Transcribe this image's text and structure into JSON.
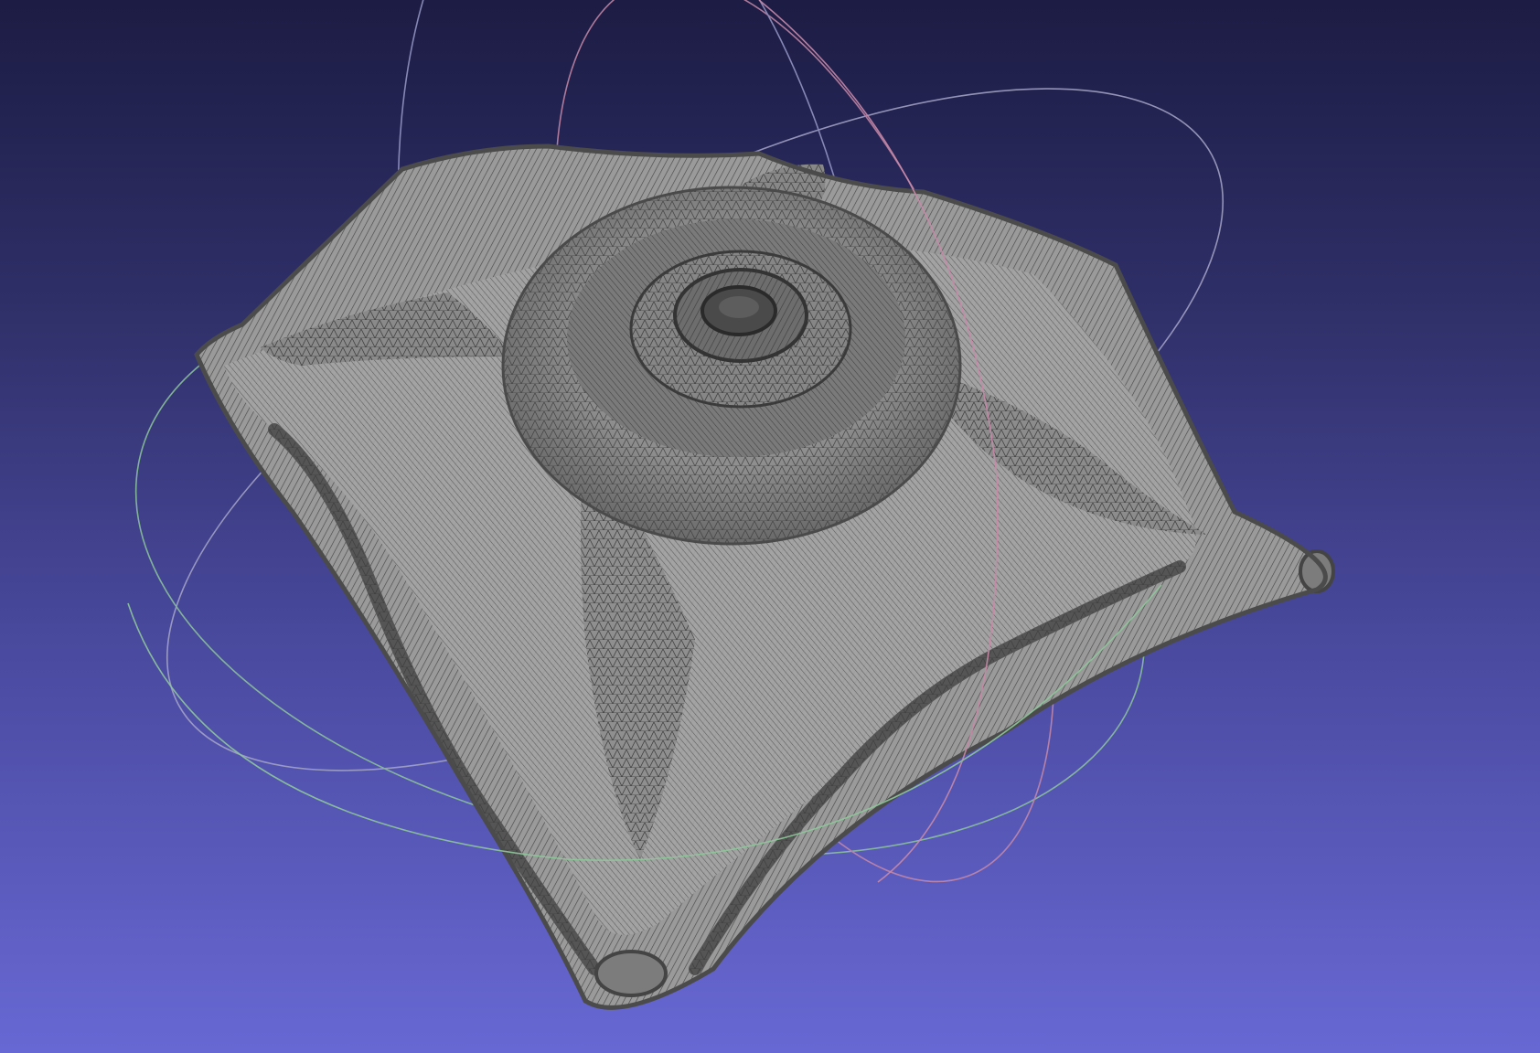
{
  "viewer": {
    "background_top": "#1c1c44",
    "background_bottom": "#6868d4",
    "mesh_fill": "#9a9a9a",
    "mesh_shade": "#6e6e6e",
    "wire_color": "#2e2e2e",
    "trackball_colors": {
      "x_ring": "#c88aa8",
      "y_ring": "#8ec89a",
      "z_ring": "#a7a7c9"
    }
  }
}
